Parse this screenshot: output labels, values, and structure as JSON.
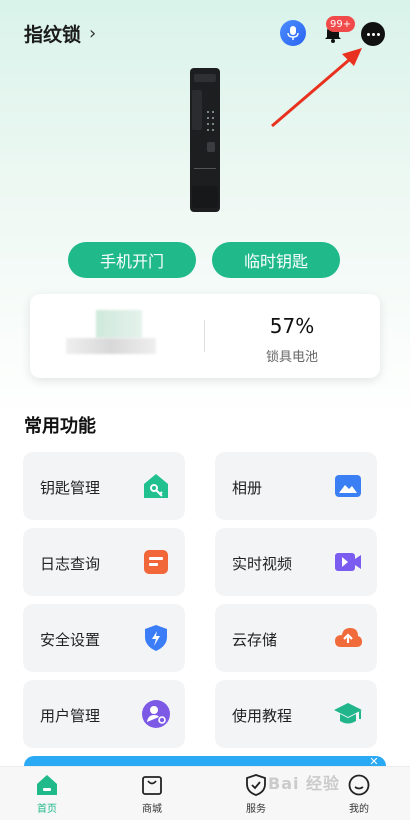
{
  "header": {
    "device_name": "指纹锁",
    "chevron": "›",
    "notification_badge": "99+"
  },
  "actions": {
    "phone_unlock": "手机开门",
    "temp_key": "临时钥匙"
  },
  "status": {
    "battery_value": "57%",
    "battery_label": "锁具电池"
  },
  "common_functions": {
    "title": "常用功能",
    "items": [
      {
        "label": "钥匙管理",
        "icon": "key-house-icon",
        "color": "#20c08f"
      },
      {
        "label": "相册",
        "icon": "photo-icon",
        "color": "#3b7ff5"
      },
      {
        "label": "日志查询",
        "icon": "log-icon",
        "color": "#f2673a"
      },
      {
        "label": "实时视频",
        "icon": "video-icon",
        "color": "#7b5cf0"
      },
      {
        "label": "安全设置",
        "icon": "shield-bolt-icon",
        "color": "#3a7df6"
      },
      {
        "label": "云存储",
        "icon": "cloud-upload-icon",
        "color": "#f06a3a"
      },
      {
        "label": "用户管理",
        "icon": "user-manage-icon",
        "color": "#7d5ae6"
      },
      {
        "label": "使用教程",
        "icon": "graduation-cap-icon",
        "color": "#20b58a"
      }
    ]
  },
  "tabbar": {
    "home": "首页",
    "shop": "商城",
    "service": "服务",
    "mine": "我的"
  },
  "watermark": "Bai 经验",
  "colors": {
    "accent": "#1fb98a",
    "badge": "#f04a4a",
    "banner": "#2aa9f4"
  }
}
